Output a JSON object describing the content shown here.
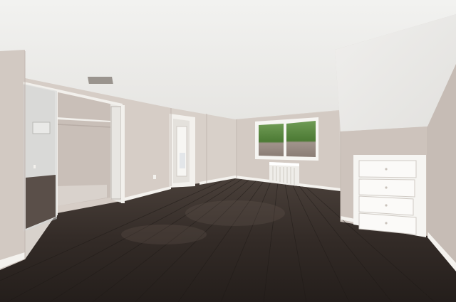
{
  "scene": {
    "kind": "photo",
    "subject": "empty-attic-bedroom",
    "colors": {
      "ceiling": "#ededeb",
      "wall": "#d6cdc6",
      "wall_shadow": "#c4bab3",
      "floor_dark": "#2b2522",
      "floor_mid": "#3c3430",
      "trim": "#f4f2ee",
      "greenery": "#4f7d3a",
      "stone": "#9b8e86"
    }
  }
}
